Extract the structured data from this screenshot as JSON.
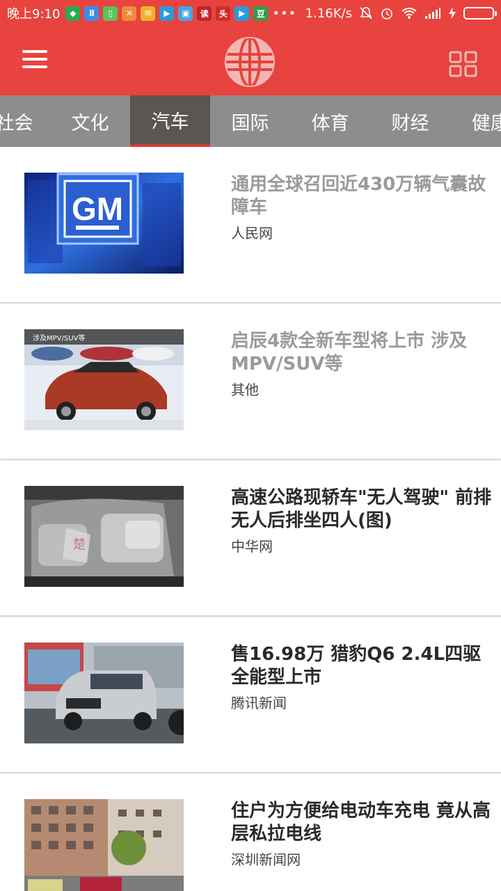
{
  "status_bar": {
    "time": "晚上9:10",
    "net_speed": "1.16K/s",
    "app_icons": [
      {
        "name": "app-icon-green",
        "color": "#2fa84f",
        "glyph": "◆"
      },
      {
        "name": "app-icon-blue",
        "color": "#3a8ee6",
        "glyph": "Ⅱ"
      },
      {
        "name": "app-icon-lightgreen",
        "color": "#5ec15a",
        "glyph": "▯"
      },
      {
        "name": "app-icon-orange",
        "color": "#f08b3a",
        "glyph": "✕"
      },
      {
        "name": "app-icon-yellow",
        "color": "#f2b12f",
        "glyph": "✉"
      },
      {
        "name": "app-icon-play",
        "color": "#2b9ad8",
        "glyph": "▶"
      },
      {
        "name": "app-icon-box",
        "color": "#4aa3df",
        "glyph": "▣"
      },
      {
        "name": "app-icon-read",
        "color": "#c0222a",
        "glyph": "读"
      },
      {
        "name": "app-icon-news",
        "color": "#d02b2b",
        "glyph": "头"
      },
      {
        "name": "app-icon-play2",
        "color": "#2b9ad8",
        "glyph": "▶"
      },
      {
        "name": "app-icon-douban",
        "color": "#2e9e4a",
        "glyph": "豆"
      }
    ],
    "more": "•••"
  },
  "header": {
    "menu_icon": "hamburger-menu-icon",
    "logo_icon": "globe-icon",
    "grid_icon": "grid-icon"
  },
  "tabs": [
    {
      "label": "社会",
      "active": false
    },
    {
      "label": "文化",
      "active": false
    },
    {
      "label": "汽车",
      "active": true
    },
    {
      "label": "国际",
      "active": false
    },
    {
      "label": "体育",
      "active": false
    },
    {
      "label": "财经",
      "active": false
    },
    {
      "label": "健康",
      "active": false
    }
  ],
  "news": [
    {
      "title": "通用全球召回近430万辆气囊故障车",
      "source": "人民网",
      "read": true,
      "thumb": "gm-logo-image"
    },
    {
      "title": "启辰4款全新车型将上市 涉及MPV/SUV等",
      "source": "其他",
      "read": true,
      "thumb": "red-suv-image",
      "thumb_caption": "涉及MPV/SUV等"
    },
    {
      "title": "高速公路现轿车\"无人驾驶\" 前排无人后排坐四人(图)",
      "source": "中华网",
      "read": false,
      "thumb": "car-interior-image"
    },
    {
      "title": "售16.98万 猎豹Q6 2.4L四驱全能型上市",
      "source": "腾讯新闻",
      "read": false,
      "thumb": "silver-suv-image"
    },
    {
      "title": "住户为方便给电动车充电 竟从高层私拉电线",
      "source": "深圳新闻网",
      "read": false,
      "thumb": "building-image"
    }
  ]
}
